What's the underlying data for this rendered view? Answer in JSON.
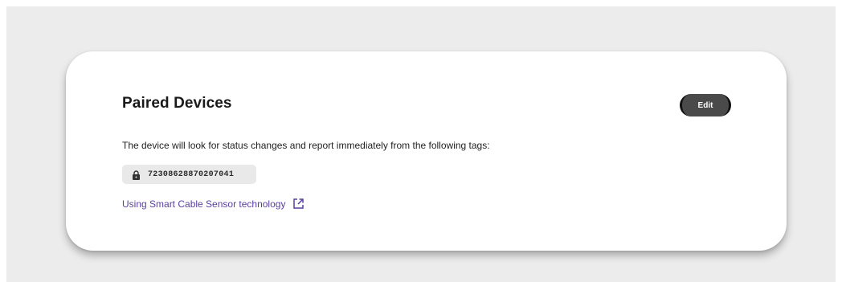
{
  "card": {
    "title": "Paired Devices",
    "edit_label": "Edit",
    "description": "The device will look for status changes and report immediately from the following tags:",
    "tags": [
      {
        "icon": "lock-icon",
        "value": "72308628870207041"
      }
    ],
    "link": {
      "label": "Using Smart Cable Sensor technology",
      "icon": "external-link-icon"
    }
  },
  "colors": {
    "backdrop": "#ececec",
    "card": "#ffffff",
    "button": "#4a4a4a",
    "link": "#5a3fa0",
    "tag_background": "#e9e9e9"
  }
}
